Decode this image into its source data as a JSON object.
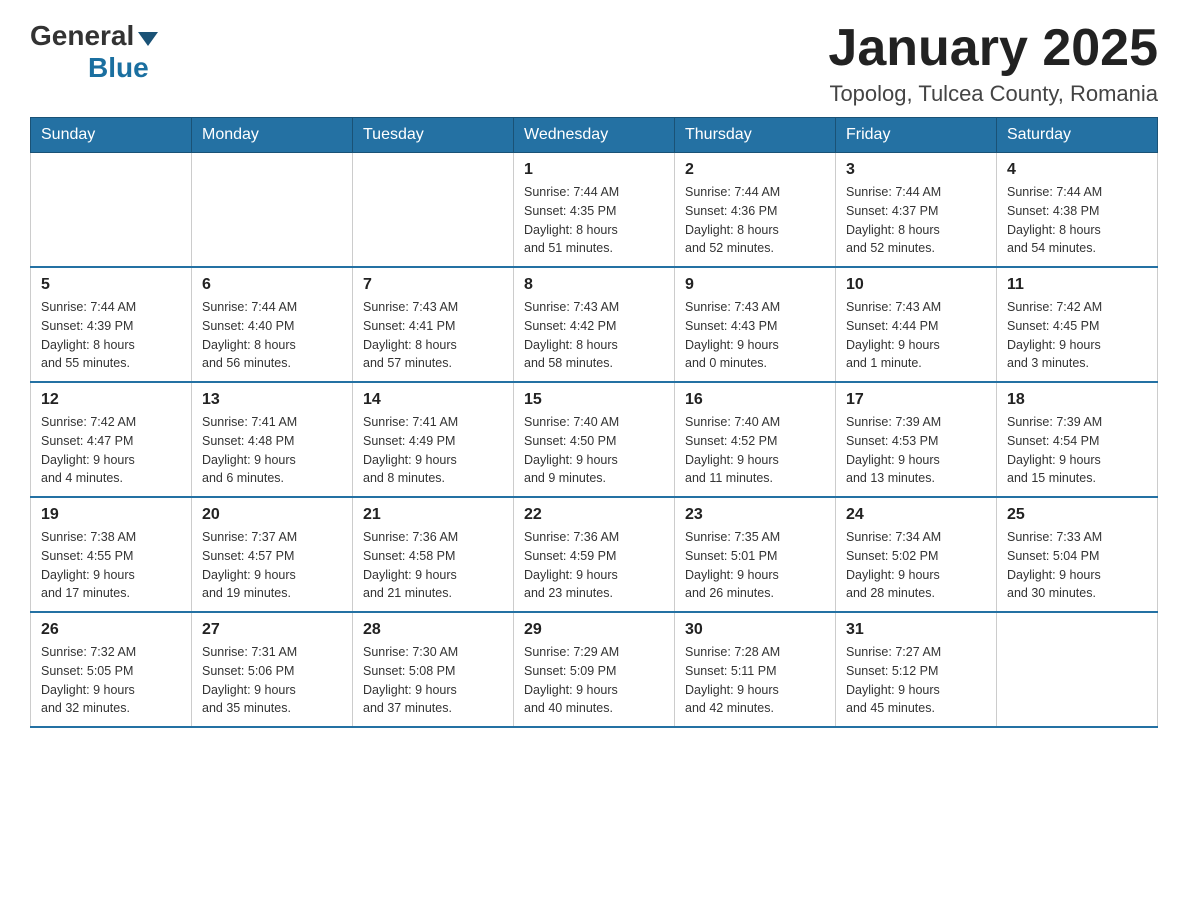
{
  "header": {
    "logo": {
      "general": "General",
      "blue": "Blue"
    },
    "title": "January 2025",
    "location": "Topolog, Tulcea County, Romania"
  },
  "days_of_week": [
    "Sunday",
    "Monday",
    "Tuesday",
    "Wednesday",
    "Thursday",
    "Friday",
    "Saturday"
  ],
  "weeks": [
    [
      {
        "day": "",
        "info": ""
      },
      {
        "day": "",
        "info": ""
      },
      {
        "day": "",
        "info": ""
      },
      {
        "day": "1",
        "info": "Sunrise: 7:44 AM\nSunset: 4:35 PM\nDaylight: 8 hours\nand 51 minutes."
      },
      {
        "day": "2",
        "info": "Sunrise: 7:44 AM\nSunset: 4:36 PM\nDaylight: 8 hours\nand 52 minutes."
      },
      {
        "day": "3",
        "info": "Sunrise: 7:44 AM\nSunset: 4:37 PM\nDaylight: 8 hours\nand 52 minutes."
      },
      {
        "day": "4",
        "info": "Sunrise: 7:44 AM\nSunset: 4:38 PM\nDaylight: 8 hours\nand 54 minutes."
      }
    ],
    [
      {
        "day": "5",
        "info": "Sunrise: 7:44 AM\nSunset: 4:39 PM\nDaylight: 8 hours\nand 55 minutes."
      },
      {
        "day": "6",
        "info": "Sunrise: 7:44 AM\nSunset: 4:40 PM\nDaylight: 8 hours\nand 56 minutes."
      },
      {
        "day": "7",
        "info": "Sunrise: 7:43 AM\nSunset: 4:41 PM\nDaylight: 8 hours\nand 57 minutes."
      },
      {
        "day": "8",
        "info": "Sunrise: 7:43 AM\nSunset: 4:42 PM\nDaylight: 8 hours\nand 58 minutes."
      },
      {
        "day": "9",
        "info": "Sunrise: 7:43 AM\nSunset: 4:43 PM\nDaylight: 9 hours\nand 0 minutes."
      },
      {
        "day": "10",
        "info": "Sunrise: 7:43 AM\nSunset: 4:44 PM\nDaylight: 9 hours\nand 1 minute."
      },
      {
        "day": "11",
        "info": "Sunrise: 7:42 AM\nSunset: 4:45 PM\nDaylight: 9 hours\nand 3 minutes."
      }
    ],
    [
      {
        "day": "12",
        "info": "Sunrise: 7:42 AM\nSunset: 4:47 PM\nDaylight: 9 hours\nand 4 minutes."
      },
      {
        "day": "13",
        "info": "Sunrise: 7:41 AM\nSunset: 4:48 PM\nDaylight: 9 hours\nand 6 minutes."
      },
      {
        "day": "14",
        "info": "Sunrise: 7:41 AM\nSunset: 4:49 PM\nDaylight: 9 hours\nand 8 minutes."
      },
      {
        "day": "15",
        "info": "Sunrise: 7:40 AM\nSunset: 4:50 PM\nDaylight: 9 hours\nand 9 minutes."
      },
      {
        "day": "16",
        "info": "Sunrise: 7:40 AM\nSunset: 4:52 PM\nDaylight: 9 hours\nand 11 minutes."
      },
      {
        "day": "17",
        "info": "Sunrise: 7:39 AM\nSunset: 4:53 PM\nDaylight: 9 hours\nand 13 minutes."
      },
      {
        "day": "18",
        "info": "Sunrise: 7:39 AM\nSunset: 4:54 PM\nDaylight: 9 hours\nand 15 minutes."
      }
    ],
    [
      {
        "day": "19",
        "info": "Sunrise: 7:38 AM\nSunset: 4:55 PM\nDaylight: 9 hours\nand 17 minutes."
      },
      {
        "day": "20",
        "info": "Sunrise: 7:37 AM\nSunset: 4:57 PM\nDaylight: 9 hours\nand 19 minutes."
      },
      {
        "day": "21",
        "info": "Sunrise: 7:36 AM\nSunset: 4:58 PM\nDaylight: 9 hours\nand 21 minutes."
      },
      {
        "day": "22",
        "info": "Sunrise: 7:36 AM\nSunset: 4:59 PM\nDaylight: 9 hours\nand 23 minutes."
      },
      {
        "day": "23",
        "info": "Sunrise: 7:35 AM\nSunset: 5:01 PM\nDaylight: 9 hours\nand 26 minutes."
      },
      {
        "day": "24",
        "info": "Sunrise: 7:34 AM\nSunset: 5:02 PM\nDaylight: 9 hours\nand 28 minutes."
      },
      {
        "day": "25",
        "info": "Sunrise: 7:33 AM\nSunset: 5:04 PM\nDaylight: 9 hours\nand 30 minutes."
      }
    ],
    [
      {
        "day": "26",
        "info": "Sunrise: 7:32 AM\nSunset: 5:05 PM\nDaylight: 9 hours\nand 32 minutes."
      },
      {
        "day": "27",
        "info": "Sunrise: 7:31 AM\nSunset: 5:06 PM\nDaylight: 9 hours\nand 35 minutes."
      },
      {
        "day": "28",
        "info": "Sunrise: 7:30 AM\nSunset: 5:08 PM\nDaylight: 9 hours\nand 37 minutes."
      },
      {
        "day": "29",
        "info": "Sunrise: 7:29 AM\nSunset: 5:09 PM\nDaylight: 9 hours\nand 40 minutes."
      },
      {
        "day": "30",
        "info": "Sunrise: 7:28 AM\nSunset: 5:11 PM\nDaylight: 9 hours\nand 42 minutes."
      },
      {
        "day": "31",
        "info": "Sunrise: 7:27 AM\nSunset: 5:12 PM\nDaylight: 9 hours\nand 45 minutes."
      },
      {
        "day": "",
        "info": ""
      }
    ]
  ]
}
